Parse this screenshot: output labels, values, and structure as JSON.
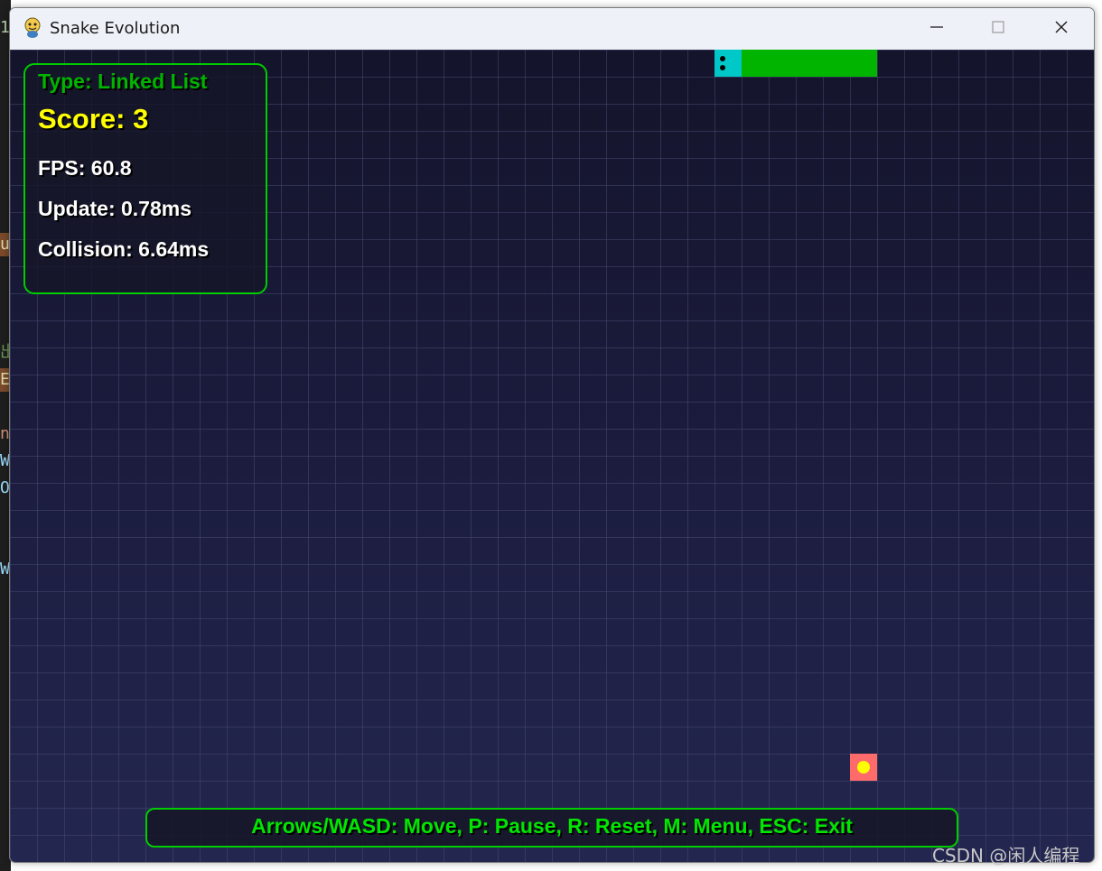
{
  "window": {
    "title": "Snake Evolution",
    "icon": "pygame-snake-icon",
    "controls": [
      "minimize",
      "maximize",
      "close"
    ]
  },
  "hud": {
    "type_text": "Type: Linked List",
    "score_text": "Score: 3",
    "fps_text": "FPS: 60.8",
    "update_text": "Update: 0.78ms",
    "collision_text": "Collision: 6.64ms"
  },
  "help": {
    "text": "Arrows/WASD: Move, P: Pause, R: Reset, M: Menu, ESC: Exit"
  },
  "desktop_fragments": [
    "1",
    "u",
    "出",
    "E",
    "n",
    "W",
    "O",
    "W"
  ],
  "watermark": "CSDN @闲人编程",
  "colors": {
    "snake_head": "#00c8c8",
    "snake_body": "#00b400",
    "food": "#ff6b6b",
    "food_center": "#ffff00",
    "hud_border": "#00cc00",
    "score": "#ffff00",
    "type": "#00b400"
  }
}
